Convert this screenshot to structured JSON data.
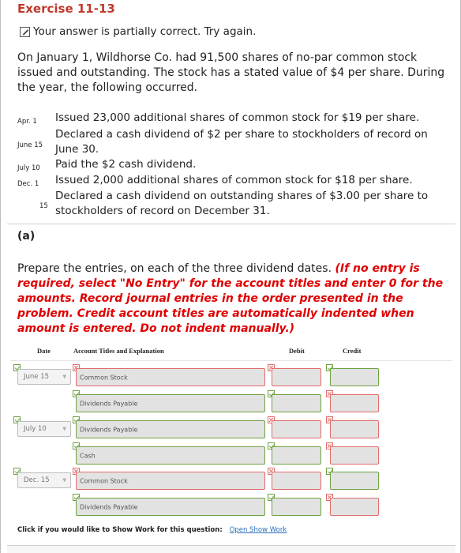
{
  "exercise": {
    "title": "Exercise 11-13",
    "status_message": "Your answer is partially correct.  Try again."
  },
  "problem": {
    "text": "On January 1, Wildhorse Co. had 91,500 shares of no-par common stock issued and outstanding. The stock has a stated value of $4 per share. During the year, the following occurred."
  },
  "events": [
    {
      "date": "Apr.  1",
      "text": "Issued 23,000 additional shares of common stock for $19 per share."
    },
    {
      "date": "June 15",
      "text": "Declared a cash dividend of $2 per share to stockholders of record on June 30."
    },
    {
      "date": "July 10",
      "text": "Paid the $2 cash dividend."
    },
    {
      "date": "Dec.  1",
      "text": "Issued 2,000 additional shares of common stock for $18 per share."
    },
    {
      "date": "15",
      "text": "Declared a cash dividend on outstanding shares of $3.00 per share to stockholders of record on December 31."
    }
  ],
  "part_a": {
    "label": "(a)",
    "instruction": "Prepare the entries, on each of the three dividend dates. ",
    "emphasis": "(If no entry is required, select \"No Entry\" for the account titles and enter 0 for the amounts. Record journal entries in the order presented in the problem. Credit account titles are automatically indented when amount is entered. Do not indent manually.)"
  },
  "table": {
    "headers": {
      "date": "Date",
      "account": "Account Titles and Explanation",
      "debit": "Debit",
      "credit": "Credit"
    },
    "rows": [
      {
        "date": "June 15",
        "account": "Common Stock",
        "account_status": "bad",
        "debit_status": "bad",
        "credit_status": "ok",
        "has_date": true
      },
      {
        "date": "",
        "account": "Dividends Payable",
        "account_status": "ok",
        "debit_status": "ok",
        "credit_status": "bad",
        "has_date": false
      },
      {
        "date": "July 10",
        "account": "Dividends Payable",
        "account_status": "ok",
        "debit_status": "bad",
        "credit_status": "bad",
        "has_date": true
      },
      {
        "date": "",
        "account": "Cash",
        "account_status": "ok",
        "debit_status": "ok",
        "credit_status": "bad",
        "has_date": false
      },
      {
        "date": "Dec. 15",
        "account": "Common Stock",
        "account_status": "bad",
        "debit_status": "bad",
        "credit_status": "ok",
        "has_date": true
      },
      {
        "date": "",
        "account": "Dividends Payable",
        "account_status": "ok",
        "debit_status": "ok",
        "credit_status": "bad",
        "has_date": false
      }
    ]
  },
  "show_work": {
    "prompt": "Click if you would like to Show Work for this question:",
    "link": "Open Show Work"
  },
  "colors": {
    "accent_red": "#c0392b",
    "instruction_red": "#e00000",
    "ok_green": "#6fa342",
    "bad_red": "#e36c6c",
    "link_blue": "#2a6ebb"
  }
}
